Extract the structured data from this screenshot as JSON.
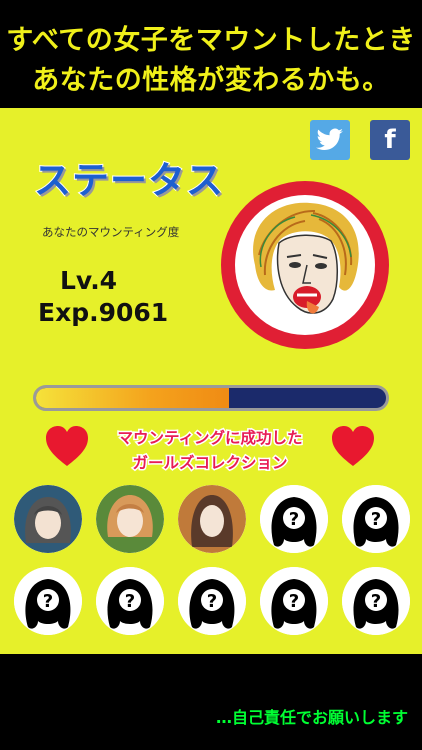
{
  "header": {
    "line1": "すべての女子をマウントしたとき",
    "line2": "あなたの性格が変わるかも。"
  },
  "share": {
    "twitter_icon": "twitter-bird-icon",
    "facebook_label": "f"
  },
  "status": {
    "title": "ステータス",
    "subtitle": "あなたのマウンティング度",
    "level": "Lv.4",
    "exp": "Exp.9061",
    "progress": 0.55
  },
  "collection": {
    "line1": "マウンティングに成功した",
    "line2": "ガールズコレクション",
    "unknown_mark": "?",
    "avatars": [
      {
        "unlocked": true,
        "style": "blue-short-hair"
      },
      {
        "unlocked": true,
        "style": "green-bob"
      },
      {
        "unlocked": true,
        "style": "brown-long-hair"
      },
      {
        "unlocked": false,
        "style": "silhouette"
      },
      {
        "unlocked": false,
        "style": "silhouette"
      },
      {
        "unlocked": false,
        "style": "silhouette"
      },
      {
        "unlocked": false,
        "style": "silhouette"
      },
      {
        "unlocked": false,
        "style": "silhouette"
      },
      {
        "unlocked": false,
        "style": "silhouette"
      },
      {
        "unlocked": false,
        "style": "silhouette"
      }
    ]
  },
  "footer": {
    "note": "…自己責任でお願いします"
  },
  "colors": {
    "accent_yellow": "#e6f02a",
    "title_blue": "#1d5fd0",
    "pink": "#e81c55",
    "heart_red": "#e8182f",
    "note_green": "#00ff33"
  }
}
